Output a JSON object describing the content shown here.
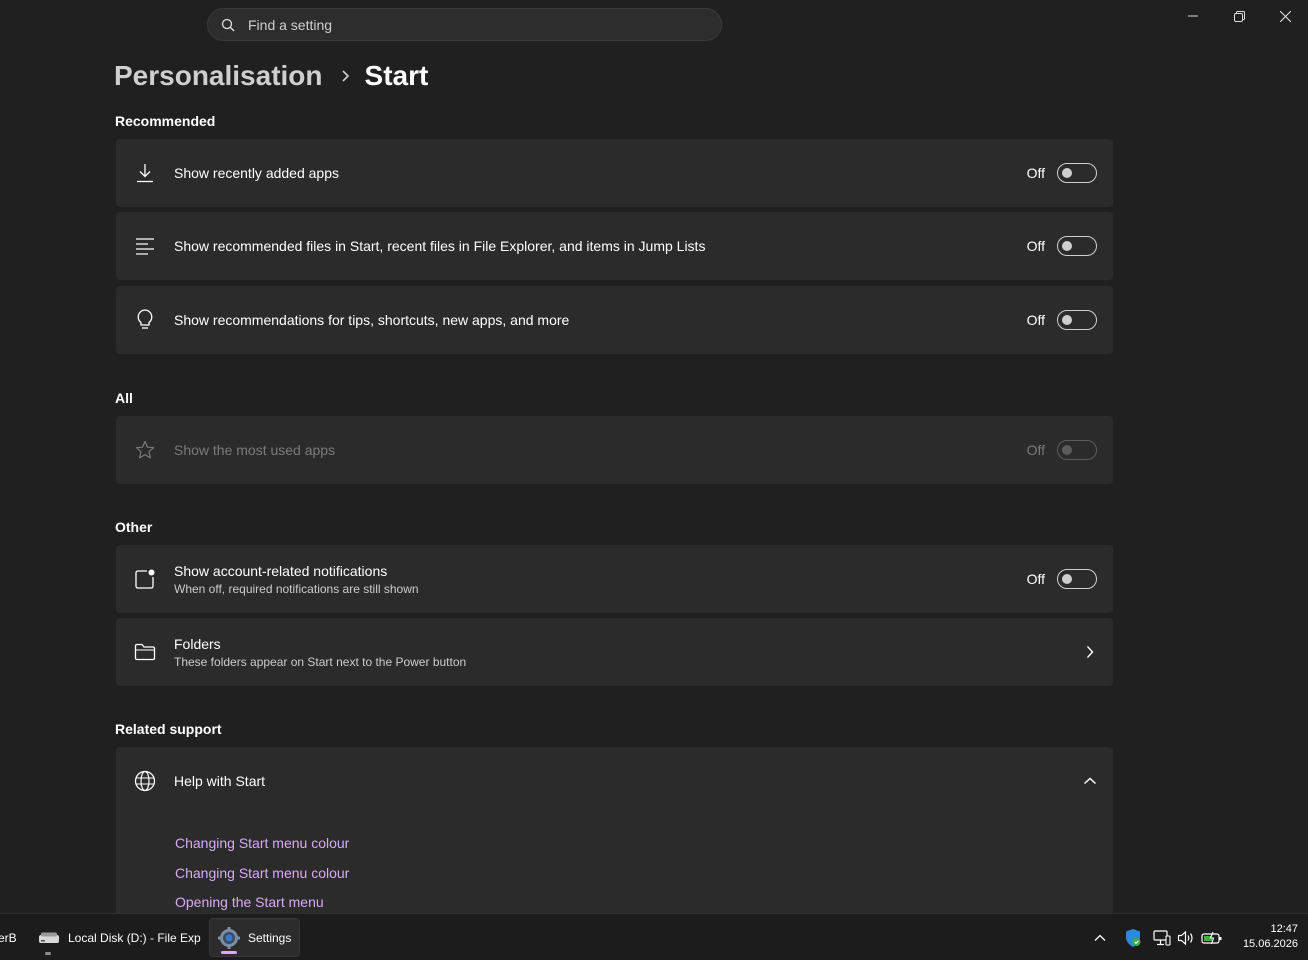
{
  "search": {
    "placeholder": "Find a setting"
  },
  "breadcrumb": {
    "parent": "Personalisation",
    "current": "Start"
  },
  "sections": {
    "recommended": "Recommended",
    "all": "All",
    "other": "Other",
    "related": "Related support"
  },
  "settings": {
    "recent_apps": {
      "title": "Show recently added apps",
      "state": "Off",
      "on": false
    },
    "recommended_files": {
      "title": "Show recommended files in Start, recent files in File Explorer, and items in Jump Lists",
      "state": "Off",
      "on": false
    },
    "tips": {
      "title": "Show recommendations for tips, shortcuts, new apps, and more",
      "state": "Off",
      "on": false
    },
    "most_used": {
      "title": "Show the most used apps",
      "state": "Off",
      "on": false,
      "disabled": true
    },
    "account_notifications": {
      "title": "Show account-related notifications",
      "subtitle": "When off, required notifications are still shown",
      "state": "Off",
      "on": false
    },
    "folders": {
      "title": "Folders",
      "subtitle": "These folders appear on Start next to the Power button"
    }
  },
  "help": {
    "title": "Help with Start",
    "expanded": true,
    "links": [
      "Changing Start menu colour",
      "Changing Start menu colour",
      "Opening the Start menu"
    ]
  },
  "taskbar": {
    "partial_label": "erB",
    "file_explorer": "Local Disk (D:) - File Exp",
    "settings": "Settings",
    "time": "12:47",
    "date": "15.06.2026"
  },
  "colors": {
    "accent_link": "#d9a9f7",
    "background": "#202020",
    "card": "#2b2b2b"
  }
}
